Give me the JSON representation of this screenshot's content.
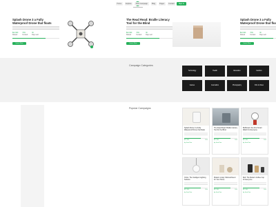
{
  "header": {
    "nav": [
      "Home",
      "Explore",
      "Start Campaign",
      "Blog",
      "Pages",
      "Contact"
    ],
    "cta_label": "Sign In"
  },
  "hero": {
    "slides": [
      {
        "title": "Splash Drone 3 a Fully Waterproof Drone that floats",
        "stats": [
          {
            "value": "$12,900",
            "label": "Raised"
          },
          {
            "value": "70%",
            "label": "Funded"
          },
          {
            "value": "30",
            "label": "Days Left"
          }
        ],
        "progress": 0.7,
        "button": "Invest Now"
      },
      {
        "title": "The Read Read: Braille Literacy Tool for the Blind",
        "stats": [
          {
            "value": "$12,900",
            "label": "Raised"
          },
          {
            "value": "70%",
            "label": "Funded"
          },
          {
            "value": "30",
            "label": "Days Left"
          }
        ],
        "progress": 0.7,
        "button": "Invest Now"
      },
      {
        "title": "Splash Drone 3 a Fully Waterproof Drone that floats",
        "stats": [
          {
            "value": "$12,900",
            "label": "Raised"
          },
          {
            "value": "70%",
            "label": "Funded"
          },
          {
            "value": "30",
            "label": "Days Left"
          }
        ],
        "progress": 0.7,
        "button": "Invest Now"
      }
    ]
  },
  "categories": {
    "title": "Campaign Categories",
    "items": [
      "Technology",
      "Health",
      "Education",
      "Fashion",
      "Games",
      "Journalism",
      "Photography",
      "Film & Video"
    ]
  },
  "projects": {
    "title": "Popular Campaigns",
    "items": [
      {
        "title": "Splash Drone 3 a Fully Waterproof Drone that floats",
        "progress": 0.7,
        "raised": "$12,900",
        "percent": "70%",
        "author": "by Jane Doe"
      },
      {
        "title": "The Read Read: Braille Literacy Tool for the Blind",
        "progress": 0.7,
        "raised": "$12,900",
        "percent": "70%",
        "author": "by Jane Doe"
      },
      {
        "title": "BoltSmart: the First Smart Watch for Everyone",
        "progress": 0.7,
        "raised": "$12,900",
        "percent": "70%",
        "author": "by Jane Doe"
      },
      {
        "title": "Circle: The Intelligent Lighting Solution",
        "progress": 0.7,
        "raised": "$12,900",
        "percent": "70%",
        "author": "by Jane Doe"
      },
      {
        "title": "Modern Living: Minimal Decor for Your Home",
        "progress": 0.7,
        "raised": "$12,900",
        "percent": "70%",
        "author": "by Jane Doe"
      },
      {
        "title": "Bolt: The Modern Coffee Cup for Everyone",
        "progress": 0.7,
        "raised": "$12,900",
        "percent": "70%",
        "author": "by Jane Doe"
      }
    ]
  },
  "colors": {
    "accent": "#27b15b",
    "tile": "#1b1b1b",
    "band": "#f2f2f2"
  }
}
